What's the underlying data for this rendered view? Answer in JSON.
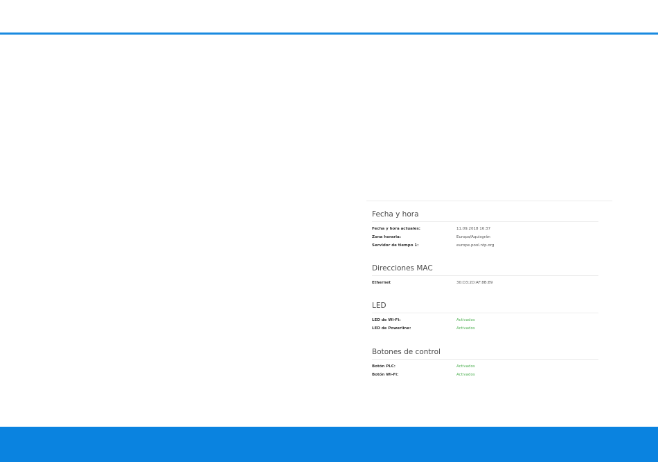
{
  "colors": {
    "accent": "#1a8ae0",
    "footer": "#0a83e0",
    "status_active": "#4caf50"
  },
  "sections": {
    "datetime": {
      "title": "Fecha y hora",
      "rows": [
        {
          "label": "Fecha y hora actuales:",
          "value": "11.09.2018 16:37"
        },
        {
          "label": "Zona horaria:",
          "value": "Europa/Aquisgrán"
        },
        {
          "label": "Servidor de tiempo 1:",
          "value": "europe.pool.ntp.org"
        }
      ]
    },
    "mac": {
      "title": "Direcciones MAC",
      "rows": [
        {
          "label": "Ethernet",
          "value": "30:D3:2D:AF:8B:89"
        }
      ]
    },
    "led": {
      "title": "LED",
      "rows": [
        {
          "label": "LED de Wi-Fi:",
          "value": "Activados"
        },
        {
          "label": "LED de Powerline:",
          "value": "Activados"
        }
      ]
    },
    "buttons": {
      "title": "Botones de control",
      "rows": [
        {
          "label": "Botón PLC:",
          "value": "Activados"
        },
        {
          "label": "Botón Wi-Fi:",
          "value": "Activados"
        }
      ]
    }
  }
}
